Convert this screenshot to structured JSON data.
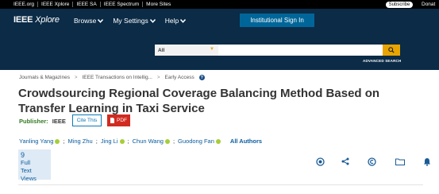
{
  "topbar": {
    "links": [
      "IEEE.org",
      "IEEE Xplore",
      "IEEE SA",
      "IEEE Spectrum",
      "More Sites"
    ],
    "subscribe": "Subscribe",
    "donate": "Donat"
  },
  "header": {
    "logo_main": "IEEE",
    "logo_italic": "Xplore",
    "nav": [
      "Browse",
      "My Settings",
      "Help"
    ],
    "signin": "Institutional Sign In",
    "search_scope": "All",
    "search_placeholder": "",
    "advanced": "ADVANCED SEARCH"
  },
  "breadcrumb": [
    "Journals & Magazines",
    "IEEE Transactions on Intellig...",
    "Early Access"
  ],
  "article": {
    "title": "Crowdsourcing Regional Coverage Balancing Method Based on Transfer Learning in Taxi Service",
    "publisher_label": "Publisher:",
    "publisher": "IEEE",
    "cite": "Cite This",
    "pdf": "PDF",
    "authors": [
      "Yanling Yang",
      "Ming Zhu",
      "Jing Li",
      "Chun Wang",
      "Guodong Fan"
    ],
    "all_authors": "All Authors",
    "metric_value": "9",
    "metric_line1": "Full",
    "metric_line2": "Text Views"
  },
  "colors": {
    "header_bg": "#0b2b47",
    "signin_bg": "#006699",
    "search_btn": "#e9a400",
    "pdf_red": "#d12b21",
    "link_blue": "#0a5b9c",
    "publisher_green": "#2f7a1f"
  },
  "icons": [
    "search-icon",
    "help-icon",
    "orcid-icon",
    "pdf-icon",
    "copyright-badge-icon",
    "share-icon",
    "rights-icon",
    "folder-icon",
    "bell-icon"
  ]
}
